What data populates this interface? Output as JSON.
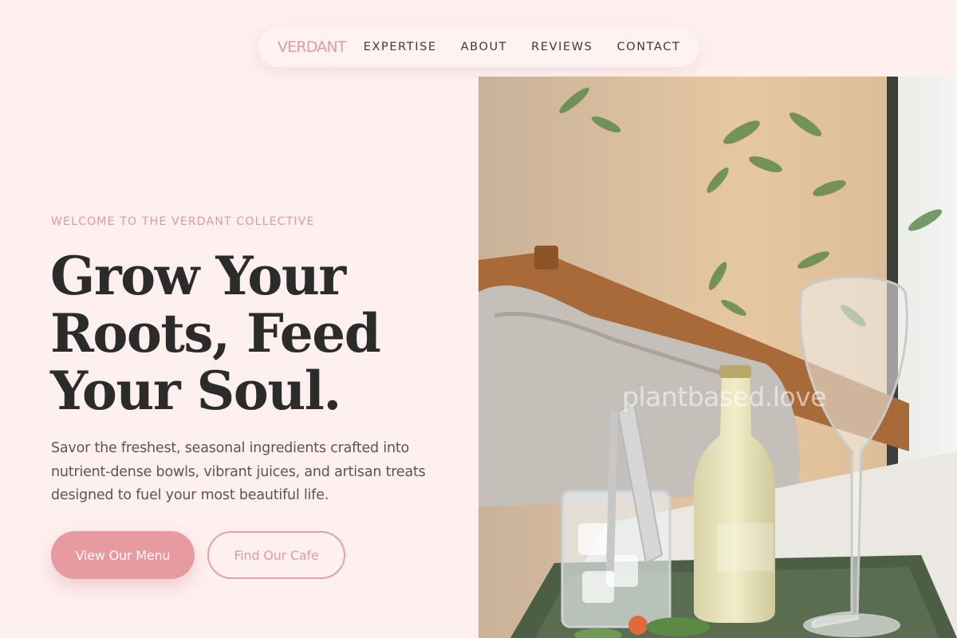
{
  "nav": {
    "brand": "VERDANT",
    "links": [
      {
        "label": "EXPERTISE"
      },
      {
        "label": "ABOUT"
      },
      {
        "label": "REVIEWS"
      },
      {
        "label": "CONTACT"
      }
    ]
  },
  "hero": {
    "eyebrow": "WELCOME TO THE VERDANT COLLECTIVE",
    "headline_lines": [
      "Grow Your",
      "Roots, Feed",
      "Your Soul."
    ],
    "subtitle": "Savor the freshest, seasonal ingredients crafted into nutrient-dense bowls, vibrant juices, and artisan treats designed to fuel your most beautiful life.",
    "primary_button": "View Our Menu",
    "secondary_button": "Find Our Cafe"
  },
  "photo": {
    "watermark": "plantbased.love"
  },
  "colors": {
    "background": "#fdf0ef",
    "accent": "#e79aa0",
    "text": "#2b2b2b"
  }
}
